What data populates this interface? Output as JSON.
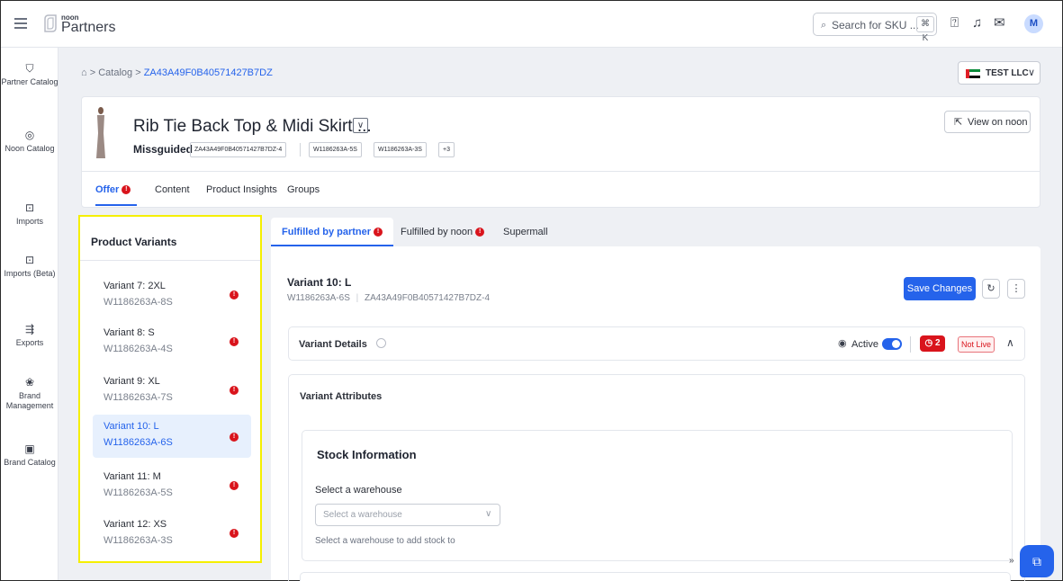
{
  "header": {
    "logo_small": "noon",
    "logo_big": "Partners",
    "search_placeholder": "Search for SKU ...",
    "search_shortcut": "⌘ K",
    "avatar_initial": "M"
  },
  "sidebar": {
    "items": [
      {
        "label": "Partner Catalog",
        "icon": "tag-icon"
      },
      {
        "label": "Noon Catalog",
        "icon": "catalog-icon"
      },
      {
        "label": "Imports",
        "icon": "import-icon"
      },
      {
        "label": "Imports (Beta)",
        "icon": "import-icon"
      },
      {
        "label": "Exports",
        "icon": "export-icon"
      },
      {
        "label": "Brand Management",
        "icon": "brand-icon"
      },
      {
        "label": "Brand Catalog",
        "icon": "brand-catalog-icon"
      }
    ]
  },
  "breadcrumb": {
    "home_icon": "home-icon",
    "sep": ">",
    "catalog": "Catalog",
    "current": "ZA43A49F0B40571427B7DZ"
  },
  "store": {
    "name": "TEST LLC"
  },
  "product": {
    "title": "Rib Tie Back Top & Midi Skirt ...",
    "brand": "Missguided",
    "tags": [
      "ZA43A49F0B40571427B7DZ-4",
      "W1186263A-5S",
      "W1186263A-3S",
      "+3"
    ],
    "view_button": "View on noon",
    "tabs": [
      {
        "label": "Offer"
      },
      {
        "label": "Content"
      },
      {
        "label": "Product Insights"
      },
      {
        "label": "Groups"
      }
    ]
  },
  "variants": {
    "title": "Product Variants",
    "items": [
      {
        "name": "Variant 7: 2XL",
        "sku": "W1186263A-8S"
      },
      {
        "name": "Variant 8: S",
        "sku": "W1186263A-4S"
      },
      {
        "name": "Variant 9: XL",
        "sku": "W1186263A-7S"
      },
      {
        "name": "Variant 10: L",
        "sku": "W1186263A-6S"
      },
      {
        "name": "Variant 11: M",
        "sku": "W1186263A-5S"
      },
      {
        "name": "Variant 12: XS",
        "sku": "W1186263A-3S"
      }
    ],
    "selected_index": 3
  },
  "offer": {
    "tabs": [
      {
        "label": "Fulfilled by partner"
      },
      {
        "label": "Fulfilled by noon"
      },
      {
        "label": "Supermall"
      }
    ],
    "variant_name": "Variant 10: L",
    "variant_sku": "W1186263A-6S",
    "variant_sku_sep": "|",
    "variant_psku": "ZA43A49F0B40571427B7DZ-4",
    "save_button": "Save Changes",
    "details_label": "Variant Details",
    "active_label": "Active",
    "error_count": "2",
    "not_live": "Not Live",
    "attributes_title": "Variant Attributes",
    "stock": {
      "title": "Stock Information",
      "warehouse_label": "Select a warehouse",
      "warehouse_placeholder": "Select a warehouse",
      "help": "Select a warehouse to add stock to"
    }
  },
  "colors": {
    "accent": "#2563eb",
    "error": "#d9141c",
    "highlight": "#f5ef00"
  }
}
